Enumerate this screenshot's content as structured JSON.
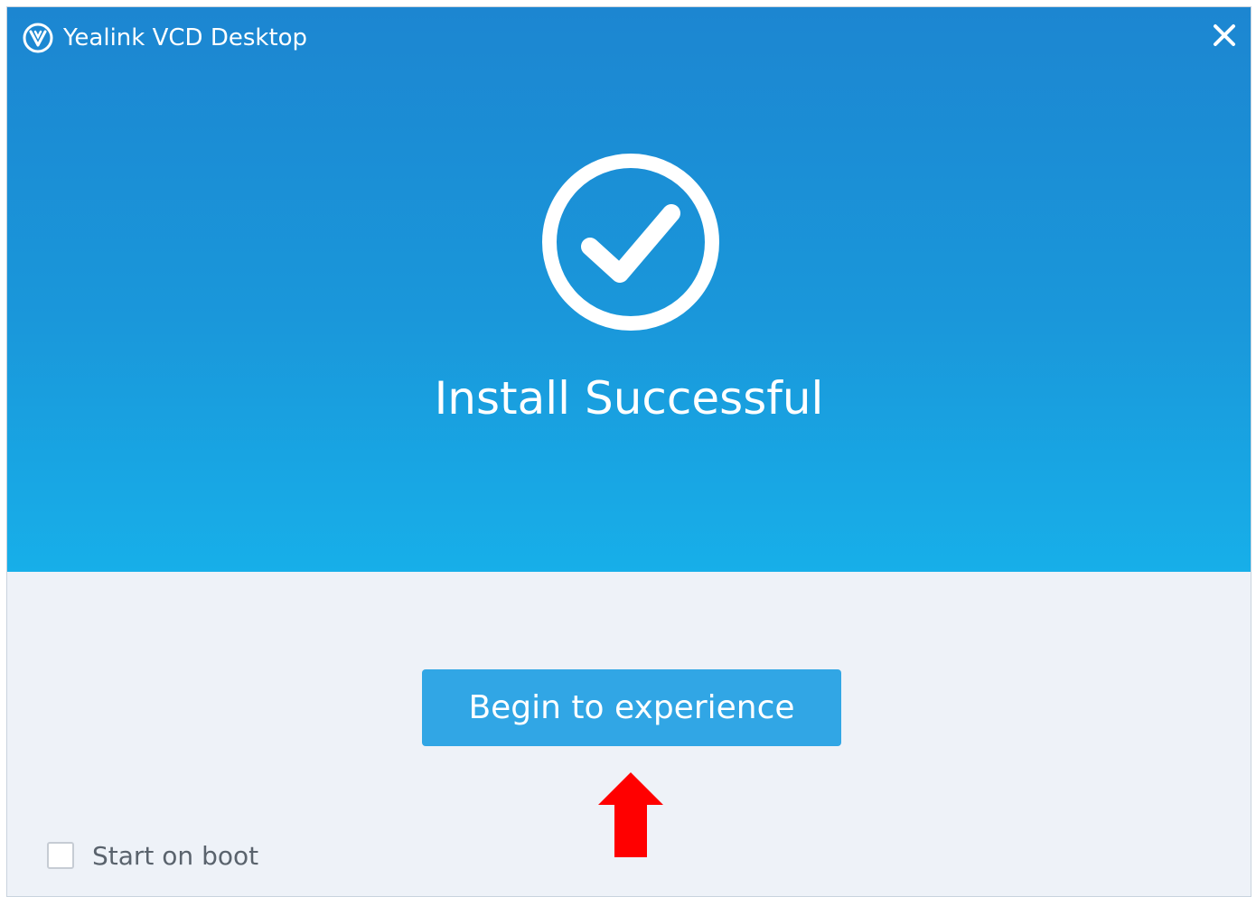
{
  "window": {
    "title": "Yealink VCD Desktop",
    "close_icon": "close-icon",
    "logo_icon": "yealink-logo-icon"
  },
  "hero": {
    "status_icon": "check-circle-icon",
    "message": "Install Successful"
  },
  "actions": {
    "primary_label": "Begin to experience",
    "pointer_icon": "red-arrow-up-icon"
  },
  "options": {
    "start_on_boot_label": "Start on boot",
    "start_on_boot_checked": false
  },
  "colors": {
    "hero_top": "#1c86d1",
    "hero_bottom": "#17afe9",
    "button": "#31a6e5",
    "footer_bg": "#eef2f8",
    "arrow": "#ff0000"
  }
}
